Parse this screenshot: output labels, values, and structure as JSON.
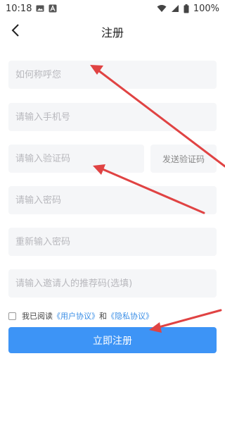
{
  "status_bar": {
    "time": "10:18",
    "battery": "100%",
    "left_icons": [
      "image-icon",
      "a-notification-icon"
    ],
    "right_icons": [
      "wifi-icon",
      "signal-icon",
      "battery-icon"
    ]
  },
  "header": {
    "title": "注册",
    "back_icon": "chevron-left-icon"
  },
  "form": {
    "nickname_placeholder": "如何称呼您",
    "phone_placeholder": "请输入手机号",
    "code_placeholder": "请输入验证码",
    "send_code_label": "发送验证码",
    "password_placeholder": "请输入密码",
    "confirm_password_placeholder": "重新输入密码",
    "referral_placeholder": "请输入邀请人的推荐码(选填)"
  },
  "agreement": {
    "prefix": "我已阅读",
    "user_agreement": "《用户协议》",
    "and": "和",
    "privacy_policy": "《隐私协议》",
    "checked": false
  },
  "submit_label": "立即注册",
  "colors": {
    "accent": "#3d94f6",
    "link": "#3a8ee6",
    "field_bg": "#f5f6f8",
    "annotation_arrow": "#e04343"
  }
}
